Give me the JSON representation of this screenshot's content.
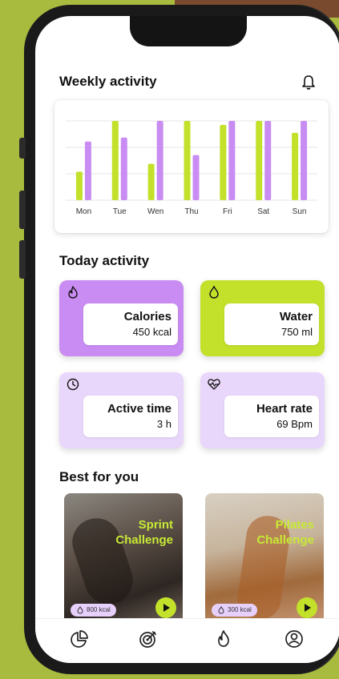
{
  "header": {
    "title": "Weekly activity",
    "icon": "bell-icon"
  },
  "chart_data": {
    "type": "bar",
    "categories": [
      "Mon",
      "Tue",
      "Wen",
      "Thu",
      "Fri",
      "Sat",
      "Sun"
    ],
    "series": [
      {
        "values": [
          36,
          100,
          46,
          100,
          95,
          100,
          85
        ]
      },
      {
        "values": [
          74,
          79,
          100,
          57,
          100,
          100,
          100
        ]
      }
    ],
    "colors": [
      "#c3e02b",
      "#c98cf2"
    ],
    "ylim": [
      0,
      100
    ],
    "grid": true
  },
  "today": {
    "title": "Today activity",
    "cards": [
      {
        "label": "Calories",
        "value": "450 kcal",
        "icon": "flame-icon",
        "color": "#c98cf2"
      },
      {
        "label": "Water",
        "value": "750 ml",
        "icon": "water-drop-icon",
        "color": "#c3e02b"
      },
      {
        "label": "Active time",
        "value": "3 h",
        "icon": "clock-icon",
        "color": "#e9d6fb"
      },
      {
        "label": "Heart rate",
        "value": "69 Bpm",
        "icon": "heart-rate-icon",
        "color": "#e9d6fb"
      }
    ]
  },
  "best": {
    "title": "Best for you",
    "items": [
      {
        "title": "Sprint\nChallenge",
        "kcal": "800 kcal"
      },
      {
        "title": "Pilates\nChallenge",
        "kcal": "300 kcal"
      }
    ]
  },
  "tabbar": [
    "chart-icon",
    "target-icon",
    "flame-icon",
    "profile-icon"
  ]
}
